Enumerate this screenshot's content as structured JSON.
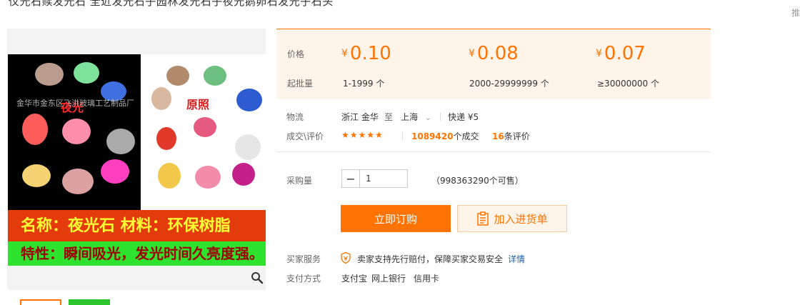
{
  "page": {
    "title_fragment": "仪光石赎发光石 全近发光石子园林发光石子夜光鹅卵石发光子石头",
    "right_glyph": "推"
  },
  "gallery": {
    "overlay_text_1": "夜光",
    "overlay_text_2": "原照",
    "watermark": "金华市金东区飞洪玻璃工艺制品厂",
    "banner_line1": "名称：夜光石 材料：环保树脂",
    "banner_line2": "特性：瞬间吸光，发光时间久亮度强。",
    "zoom_icon": "magnifier-icon"
  },
  "price_panel": {
    "price_label": "价格",
    "qty_label": "起批量",
    "tiers": [
      {
        "currency": "¥",
        "price": "0.10",
        "qty": "1-1999 个"
      },
      {
        "currency": "¥",
        "price": "0.08",
        "qty": "2000-29999999 个"
      },
      {
        "currency": "¥",
        "price": "0.07",
        "qty": "≥30000000 个"
      }
    ]
  },
  "logistics": {
    "label": "物流",
    "from": "浙江 金华",
    "to_word": "至",
    "to": "上海",
    "express": "快递 ¥5"
  },
  "deals": {
    "label": "成交\\评价",
    "stars": "★★★★★",
    "count": "1089420",
    "count_suffix": "个成交",
    "reviews": "16",
    "reviews_suffix": "条评价"
  },
  "purchase": {
    "label": "采购量",
    "value": "1",
    "stock": "（998363290个可售）",
    "buy_label": "立即订购",
    "cart_label": "加入进货单"
  },
  "service": {
    "label": "买家服务",
    "text": "卖家支持先行赔付，保障买家交易安全",
    "link": "详情"
  },
  "payment": {
    "label": "支付方式",
    "methods": [
      "支付宝",
      "网上银行",
      "信用卡"
    ]
  },
  "colors": {
    "accent": "#ff7300",
    "panel_bg": "#fff4ea",
    "link": "#1e5fa6"
  }
}
